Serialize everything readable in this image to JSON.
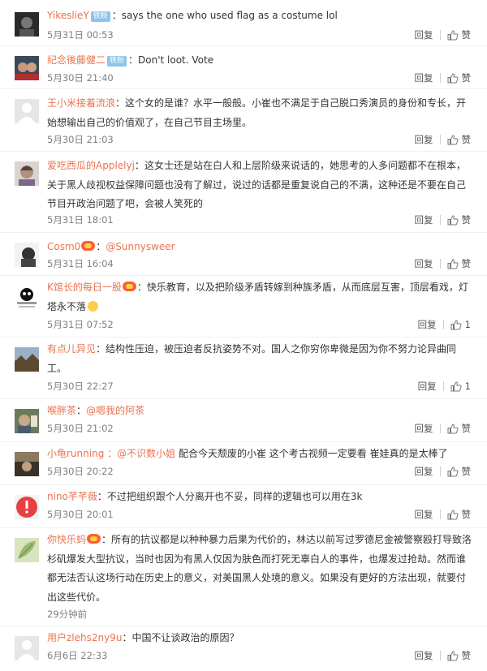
{
  "ui": {
    "reply_label": "回复",
    "like_label": "赞"
  },
  "comments": [
    {
      "user": "YikeslieY",
      "badge": "铁粉",
      "text": "：says the one who used flag as a costume  lol",
      "time": "5月31日 00:53",
      "likes": "赞"
    },
    {
      "user": "纪念後藤健二",
      "badge": "铁粉",
      "text": "：Don't loot. Vote",
      "time": "5月30日 21:40",
      "likes": "赞"
    },
    {
      "user": "王小米接着流浪",
      "text": "：这个女的是谁？水平一般般。小崔也不满足于自己脱口秀演员的身份和专长，开始想输出自己的价值观了，在自己节目主场里。",
      "time": "5月30日 21:03",
      "likes": "赞"
    },
    {
      "user": "爱吃西瓜的Applelyj",
      "text": "：这女士还是站在白人和上层阶级来说话的，她思考的人多问题都不在根本，关于黑人歧视权益保障问题也没有了解过，说过的话都是重复说自己的不满，这种还是不要在自己节目开政治问题了吧，会被人笑死的",
      "time": "5月31日 18:01",
      "likes": "赞"
    },
    {
      "user": "Cosm0",
      "text": "：",
      "mention": "@Sunnysweer",
      "time": "5月31日 16:04",
      "likes": "赞"
    },
    {
      "user": "K馆长的每日一股",
      "text": "：快乐教育，以及把阶级矛盾转嫁到种族矛盾，从而底层互害，顶层看戏，灯塔永不落",
      "time": "5月31日 07:52",
      "likes": "1"
    },
    {
      "user": "有点儿异见",
      "text": "：结构性压迫，被压迫者反抗姿势不对。国人之你穷你卑微是因为你不努力论异曲同工。",
      "time": "5月30日 22:27",
      "likes": "1"
    },
    {
      "user": "喉胖茶",
      "text": "：",
      "mention": "@嗯我的阿茶",
      "time": "5月30日 21:02",
      "likes": "赞"
    },
    {
      "user": "小龟running",
      "text": "配合今天颓废的小崔 这个考古视频一定要看 崔娃真的是太棒了",
      "mention": "：@不识数小姐",
      "time": "5月30日 20:22",
      "likes": "赞"
    },
    {
      "user": "nino芊芊薇",
      "text": "：不过把组织跟个人分离开也不妥，同样的逻辑也可以用在3k",
      "time": "5月30日 20:01",
      "likes": "赞"
    },
    {
      "user": "你快乐蚂",
      "text": "：所有的抗议都是以种种暴力后果为代价的，林达以前写过罗德尼金被警察殴打导致洛杉矶爆发大型抗议，当时也因为有黑人仅因为肤色而打死无辜白人的事件，也爆发过抢劫。然而谁都无法否认这场行动在历史上的意义，对美国黑人处境的意义。如果没有更好的方法出现，就要付出这些代价。",
      "time": "29分钟前",
      "likes": "赞"
    },
    {
      "user": "用户zlehs2ny9u",
      "text": "：中国不让谈政治的原因？",
      "time": "6月6日 22:33",
      "likes": "赞"
    }
  ]
}
